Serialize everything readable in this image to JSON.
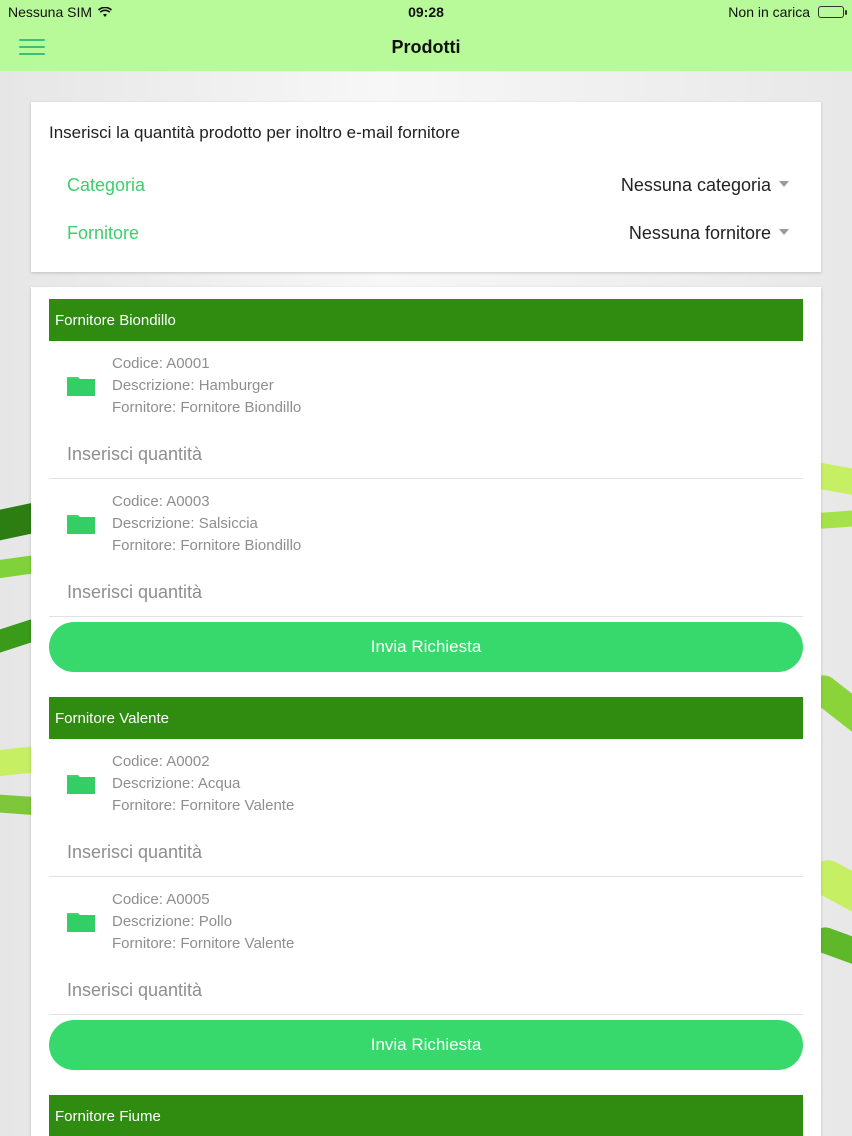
{
  "status_bar": {
    "carrier": "Nessuna SIM",
    "time": "09:28",
    "battery_status": "Non in carica"
  },
  "nav": {
    "title": "Prodotti",
    "menu_icon": "hamburger-menu-icon"
  },
  "filters": {
    "header": "Inserisci la quantità prodotto per inoltro e-mail fornitore",
    "category_label": "Categoria",
    "category_value": "Nessuna categoria",
    "supplier_label": "Fornitore",
    "supplier_value": "Nessuna fornitore"
  },
  "groups": [
    {
      "title": "Fornitore Biondillo",
      "products": [
        {
          "code": "Codice: A0001",
          "description": "Descrizione: Hamburger",
          "supplier": "Fornitore: Fornitore Biondillo",
          "qty_placeholder": "Inserisci quantità"
        },
        {
          "code": "Codice: A0003",
          "description": "Descrizione: Salsiccia",
          "supplier": "Fornitore: Fornitore Biondillo",
          "qty_placeholder": "Inserisci quantità"
        }
      ],
      "send_label": "Invia Richiesta"
    },
    {
      "title": "Fornitore Valente",
      "products": [
        {
          "code": "Codice: A0002",
          "description": "Descrizione: Acqua",
          "supplier": "Fornitore: Fornitore Valente",
          "qty_placeholder": "Inserisci quantità"
        },
        {
          "code": "Codice: A0005",
          "description": "Descrizione: Pollo",
          "supplier": "Fornitore: Fornitore Valente",
          "qty_placeholder": "Inserisci quantità"
        }
      ],
      "send_label": "Invia Richiesta"
    },
    {
      "title": "Fornitore Fiume"
    }
  ],
  "colors": {
    "header_bar": "#b8f99a",
    "accent_green": "#3dce6b",
    "group_header": "#2f8c10",
    "button": "#37d96c"
  }
}
